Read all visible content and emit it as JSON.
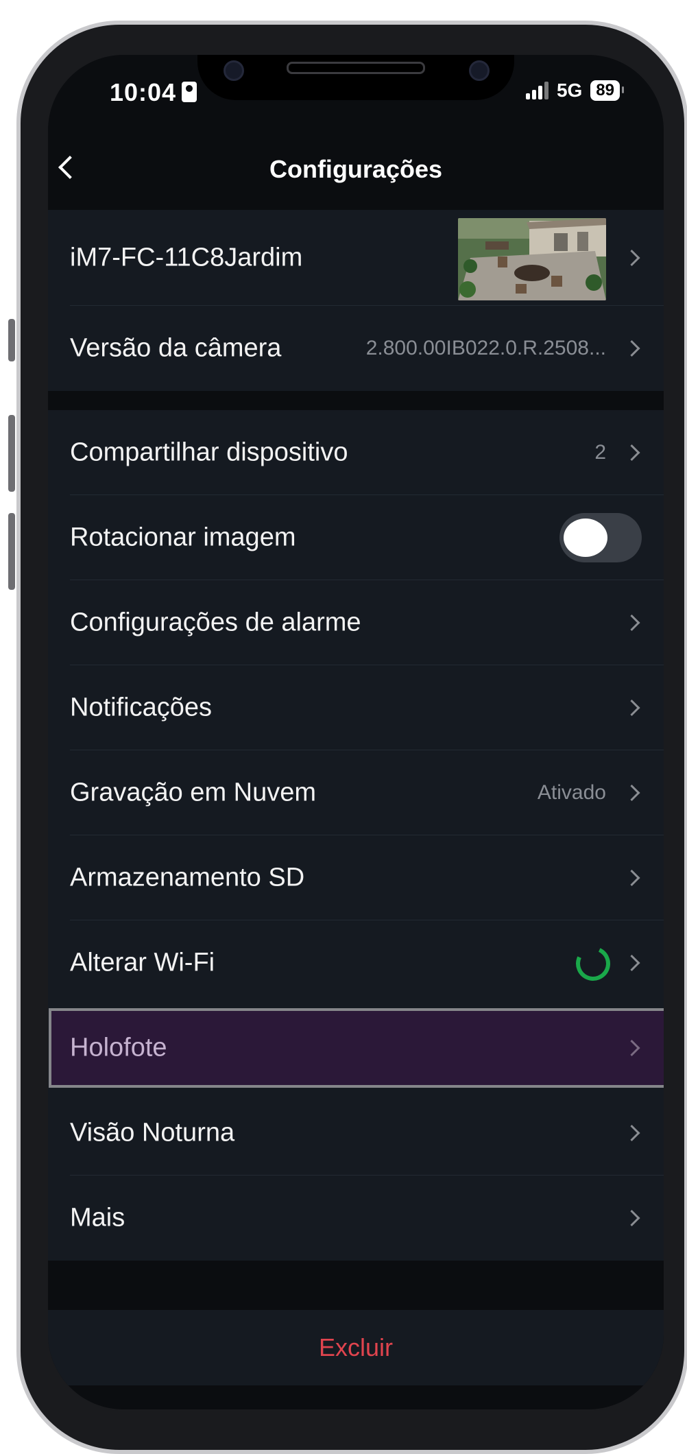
{
  "status_bar": {
    "time": "10:04",
    "network": "5G",
    "battery": "89"
  },
  "header": {
    "title": "Configurações"
  },
  "device": {
    "name": "iM7-FC-11C8Jardim",
    "version_label": "Versão da câmera",
    "version_value": "2.800.00IB022.0.R.2508..."
  },
  "settings": [
    {
      "label": "Compartilhar dispositivo",
      "value": "2"
    },
    {
      "label": "Rotacionar imagem",
      "toggle_on": false
    },
    {
      "label": "Configurações de alarme"
    },
    {
      "label": "Notificações"
    },
    {
      "label": "Gravação em Nuvem",
      "value": "Ativado"
    },
    {
      "label": "Armazenamento SD"
    },
    {
      "label": "Alterar Wi-Fi",
      "status_icon": "loading-spinner-icon"
    },
    {
      "label": "Holofote",
      "highlighted": true
    },
    {
      "label": "Visão Noturna"
    },
    {
      "label": "Mais"
    }
  ],
  "footer": {
    "delete_label": "Excluir"
  },
  "colors": {
    "accent_highlight": "#2b1838",
    "delete": "#e0444e",
    "spinner": "#1aa84a"
  }
}
